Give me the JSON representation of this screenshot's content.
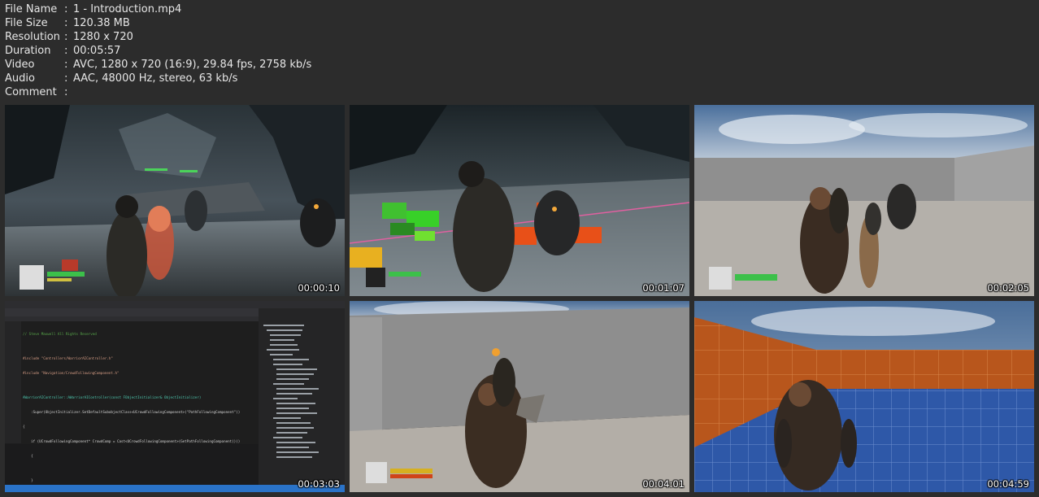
{
  "file_info": [
    {
      "key": "File Name",
      "value": "1 - Introduction.mp4"
    },
    {
      "key": "File Size",
      "value": "120.38 MB"
    },
    {
      "key": "Resolution",
      "value": "1280 x 720"
    },
    {
      "key": "Duration",
      "value": "00:05:57"
    },
    {
      "key": "Video",
      "value": "AVC, 1280 x 720 (16:9), 29.84 fps, 2758 kb/s"
    },
    {
      "key": "Audio",
      "value": "AAC, 48000 Hz, stereo, 63 kb/s"
    },
    {
      "key": "Comment",
      "value": ""
    }
  ],
  "separator": ":",
  "thumbnails": [
    {
      "timestamp": "00:00:10",
      "scene": "dark-cave-combat"
    },
    {
      "timestamp": "00:01:07",
      "scene": "navmesh-combat"
    },
    {
      "timestamp": "00:02:05",
      "scene": "grey-arena"
    },
    {
      "timestamp": "00:03:03",
      "scene": "code-editor"
    },
    {
      "timestamp": "00:04:01",
      "scene": "grey-arena-attack"
    },
    {
      "timestamp": "00:04:59",
      "scene": "orange-arena"
    }
  ],
  "code_lines": [
    "// Steve Maxwell All Rights Reserved",
    "",
    "#include \"Controllers/WarriorAIController.h\"",
    "#include \"Navigation/CrowdFollowingComponent.h\"",
    "",
    "AWarriorAIController::AWarriorAIController(const FObjectInitializer& ObjectInitializer)",
    "    :Super(ObjectInitializer.SetDefaultSubobjectClass<UCrowdFollowingComponent>(\"PathFollowingComponent\"))",
    "{",
    "    if (UCrowdFollowingComponent* CrowdComp = Cast<UCrowdFollowingComponent>(GetPathFollowingComponent()))",
    "    {",
    "",
    "    }",
    "}"
  ]
}
